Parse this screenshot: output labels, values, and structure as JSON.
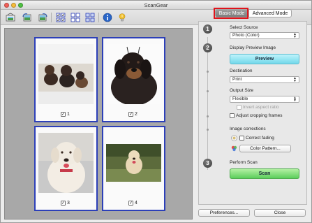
{
  "window": {
    "title": "ScanGear"
  },
  "toolbar": {
    "icons": [
      "scan-icon",
      "preview-icon",
      "crop-icon",
      "select-all-icon",
      "grid-icon",
      "multi-icon",
      "info-icon",
      "hint-icon"
    ]
  },
  "preview": {
    "thumbnails": [
      {
        "number": "1",
        "checked": true
      },
      {
        "number": "2",
        "checked": true
      },
      {
        "number": "3",
        "checked": true
      },
      {
        "number": "4",
        "checked": true
      }
    ]
  },
  "tabs": {
    "basic": "Basic Mode",
    "advanced": "Advanced Mode"
  },
  "steps": {
    "s1": {
      "number": "1",
      "label": "Select Source",
      "value": "Photo (Color)"
    },
    "s2": {
      "number": "2",
      "label": "Display Preview Image",
      "button": "Preview"
    },
    "destination": {
      "label": "Destination",
      "value": "Print"
    },
    "output_size": {
      "label": "Output Size",
      "value": "Flexible",
      "invert": "Invert aspect ratio"
    },
    "adjust_frames": "Adjust cropping frames",
    "image_corrections": {
      "label": "Image corrections",
      "correct_fading": "Correct fading",
      "color_pattern": "Color Pattern..."
    },
    "s3": {
      "number": "3",
      "label": "Perform Scan",
      "button": "Scan"
    }
  },
  "bottom": {
    "preferences": "Preferences...",
    "close": "Close"
  },
  "colors": {
    "accent_blue": "#2c3fb8",
    "preview_btn": "#72d8ea",
    "scan_btn": "#5bce5b",
    "highlight": "#e0141b"
  }
}
